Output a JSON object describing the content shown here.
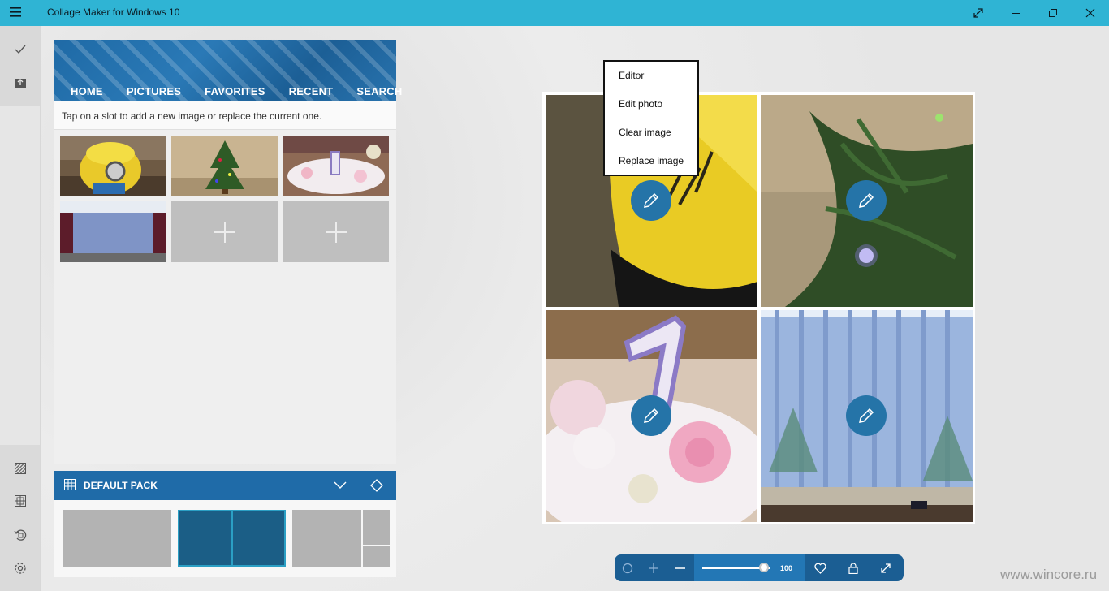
{
  "window": {
    "title": "Collage Maker for Windows 10",
    "accent": "#2fb4d4"
  },
  "rail": {
    "top_icons": [
      "check-icon",
      "upload-icon"
    ],
    "bottom_icons": [
      "texture-icon",
      "grid-layout-icon",
      "rotate-icon",
      "settings-icon"
    ]
  },
  "panel": {
    "nav": [
      "HOME",
      "PICTURES",
      "FAVORITES",
      "RECENT",
      "SEARCH"
    ],
    "hint": "Tap on a slot to add a new image or replace the current one.",
    "thumbnails": [
      {
        "kind": "image",
        "subject": "yellow toy"
      },
      {
        "kind": "image",
        "subject": "christmas tree"
      },
      {
        "kind": "image",
        "subject": "birthday cake"
      },
      {
        "kind": "image",
        "subject": "stage curtain"
      },
      {
        "kind": "empty"
      },
      {
        "kind": "empty"
      }
    ]
  },
  "pack": {
    "label": "DEFAULT PACK",
    "layouts": [
      "single",
      "two-column",
      "one-plus-two"
    ],
    "selected_layout": 1
  },
  "context_menu": {
    "items": [
      "Editor",
      "Edit photo",
      "Clear image",
      "Replace image"
    ]
  },
  "toolbar": {
    "zoom_value": "100",
    "zoom_fraction": 0.9,
    "icons": [
      "shape-icon",
      "zoom-in-icon",
      "zoom-out-icon",
      "heart-icon",
      "lock-icon",
      "fullscreen-icon"
    ]
  },
  "watermark": "www.wincore.ru"
}
